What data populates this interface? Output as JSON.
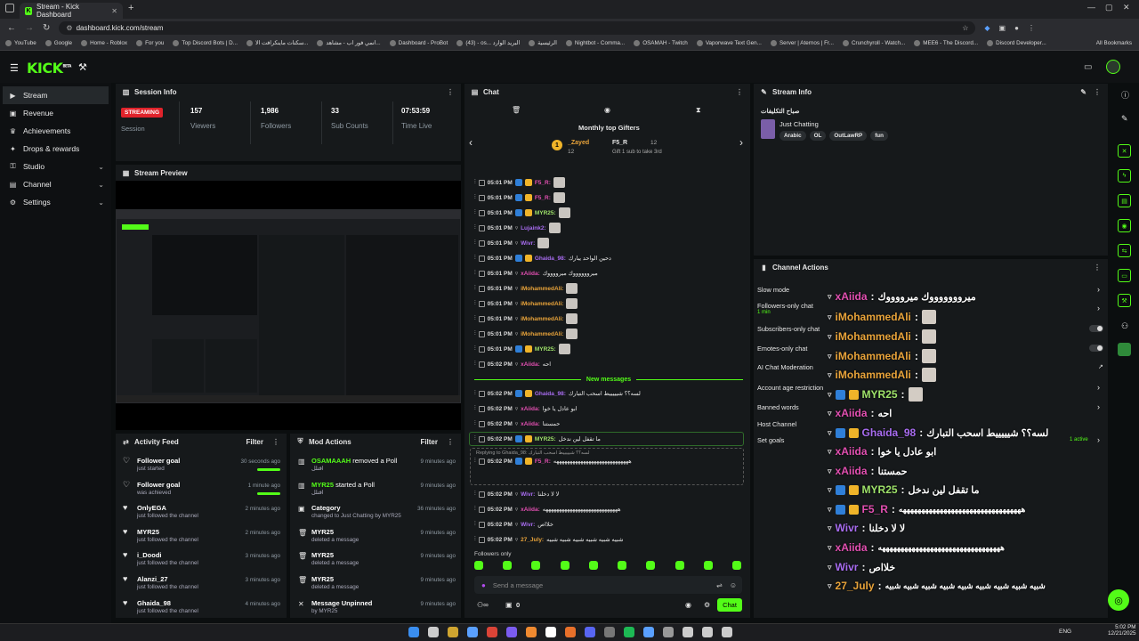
{
  "browser": {
    "tab_title": "Stream - Kick Dashboard",
    "url": "dashboard.kick.com/stream",
    "bookmarks": [
      "YouTube",
      "Google",
      "Home - Roblox",
      "For you",
      "Top Discord Bots | D...",
      "سكنات ماينكرافت الا...",
      "انمي فور اب - مشاهد...",
      "Dashboard - ProBot",
      "(43) - os... البريد الوارد",
      "الرئيسية",
      "Nightbot - Comma...",
      "OSAMAH - Twitch",
      "Vaporwave Text Gen...",
      "Server | Aternos | Fr...",
      "Crunchyroll - Watch...",
      "MEE6 - The Discord...",
      "Discord Developer..."
    ],
    "all_bookmarks": "All Bookmarks"
  },
  "app": {
    "logo": "KICK",
    "beta": "BETA"
  },
  "nav": [
    {
      "label": "Stream",
      "icon": "video-icon"
    },
    {
      "label": "Revenue",
      "icon": "wallet-icon"
    },
    {
      "label": "Achievements",
      "icon": "trophy-icon"
    },
    {
      "label": "Drops & rewards",
      "icon": "gift-icon"
    },
    {
      "label": "Studio",
      "icon": "studio-icon"
    },
    {
      "label": "Channel",
      "icon": "channel-icon"
    },
    {
      "label": "Settings",
      "icon": "gear-icon"
    }
  ],
  "session": {
    "title": "Session Info",
    "status": "STREAMING",
    "status_label": "Session",
    "stats": [
      {
        "value": "157",
        "label": "Viewers"
      },
      {
        "value": "1,986",
        "label": "Followers"
      },
      {
        "value": "33",
        "label": "Sub Counts"
      },
      {
        "value": "07:53:59",
        "label": "Time Live"
      }
    ]
  },
  "preview": {
    "title": "Stream Preview"
  },
  "activity": {
    "title": "Activity Feed",
    "filter": "Filter",
    "items": [
      {
        "title": "Follower goal",
        "sub": "just started",
        "time": "30 seconds ago",
        "bar": true
      },
      {
        "title": "Follower goal",
        "sub": "was achieved",
        "time": "1 minute ago",
        "bar": true
      },
      {
        "title": "OnlyEGA",
        "sub": "just followed the channel",
        "time": "2 minutes ago"
      },
      {
        "title": "MYR25",
        "sub": "just followed the channel",
        "time": "2 minutes ago"
      },
      {
        "title": "i_Doodi",
        "sub": "just followed the channel",
        "time": "3 minutes ago"
      },
      {
        "title": "Alanzi_27",
        "sub": "just followed the channel",
        "time": "3 minutes ago"
      },
      {
        "title": "Ghaida_98",
        "sub": "just followed the channel",
        "time": "4 minutes ago"
      }
    ]
  },
  "modactions": {
    "title": "Mod Actions",
    "filter": "Filter",
    "items": [
      {
        "user": "OSAMAAAH",
        "action": " removed a Poll",
        "sub": "اقتلل",
        "time": "9 minutes ago"
      },
      {
        "user": "MYR25",
        "action": " started a Poll",
        "sub": "اقتلل",
        "time": "9 minutes ago"
      },
      {
        "user": "",
        "action": "Category",
        "sub": "changed to Just Chatting by MYR25",
        "time": "36 minutes ago"
      },
      {
        "user": "",
        "action": "MYR25",
        "sub": "deleted a message",
        "time": "9 minutes ago"
      },
      {
        "user": "",
        "action": "MYR25",
        "sub": "deleted a message",
        "time": "9 minutes ago"
      },
      {
        "user": "",
        "action": "MYR25",
        "sub": "deleted a message",
        "time": "9 minutes ago"
      },
      {
        "user": "",
        "action": "Message Unpinned",
        "sub": "by MYR25",
        "time": "9 minutes ago"
      }
    ]
  },
  "chat": {
    "title": "Chat",
    "gifters_title": "Monthly top Gifters",
    "gifter1": "_Zayed",
    "gifter1_count": "12",
    "gifter2": "F5_R",
    "gifter2_count": "12",
    "gift_hint": "Gift 1 sub to take 3rd",
    "new_messages": "New messages",
    "followers_only": "Followers only",
    "placeholder": "Send a message",
    "send": "Chat",
    "count0": "0",
    "lines": [
      {
        "time": "05:01 PM",
        "user": "F5_R:",
        "color": "#e14fb0",
        "msg": ""
      },
      {
        "time": "05:01 PM",
        "user": "F5_R:",
        "color": "#e14fb0",
        "msg": ""
      },
      {
        "time": "05:01 PM",
        "user": "MYR25:",
        "color": "#9fe36a",
        "msg": ""
      },
      {
        "time": "05:01 PM",
        "user": "Lujaink2:",
        "color": "#a86cf0",
        "msg": ""
      },
      {
        "time": "05:01 PM",
        "user": "Wivr:",
        "color": "#a86cf0",
        "msg": ""
      },
      {
        "time": "05:01 PM",
        "user": "Ghaida_98:",
        "color": "#a86cf0",
        "msg": "دحين الواحد يبارك"
      },
      {
        "time": "05:01 PM",
        "user": "xAiida:",
        "color": "#e14fb0",
        "msg": "ميرووووووك ميرووووك"
      },
      {
        "time": "05:01 PM",
        "user": "iMohammedAli:",
        "color": "#e8a33a",
        "msg": ""
      },
      {
        "time": "05:01 PM",
        "user": "iMohammedAli:",
        "color": "#e8a33a",
        "msg": ""
      },
      {
        "time": "05:01 PM",
        "user": "iMohammedAli:",
        "color": "#e8a33a",
        "msg": ""
      },
      {
        "time": "05:01 PM",
        "user": "iMohammedAli:",
        "color": "#e8a33a",
        "msg": ""
      },
      {
        "time": "05:01 PM",
        "user": "MYR25:",
        "color": "#9fe36a",
        "msg": ""
      },
      {
        "time": "05:02 PM",
        "user": "xAiida:",
        "color": "#e14fb0",
        "msg": "احه"
      },
      {
        "time": "05:02 PM",
        "user": "Ghaida_98:",
        "color": "#a86cf0",
        "msg": "لسه؟؟ شيييييط اسحب التبارك"
      },
      {
        "time": "05:02 PM",
        "user": "xAiida:",
        "color": "#e14fb0",
        "msg": "ابو عادل يا خوا"
      },
      {
        "time": "05:02 PM",
        "user": "xAiida:",
        "color": "#e14fb0",
        "msg": "حمستنا"
      },
      {
        "time": "05:02 PM",
        "user": "MYR25:",
        "color": "#9fe36a",
        "msg": "ما تقفل لين ندخل"
      },
      {
        "time": "05:02 PM",
        "user": "F5_R:",
        "color": "#e14fb0",
        "msg": "ههههههههههههههههههههههههههههه"
      },
      {
        "time": "05:02 PM",
        "user": "Wivr:",
        "color": "#a86cf0",
        "msg": "لا لا دخلنا"
      },
      {
        "time": "05:02 PM",
        "user": "xAiida:",
        "color": "#e14fb0",
        "msg": "ههههههههههههههههههههههههههههه"
      },
      {
        "time": "05:02 PM",
        "user": "Wivr:",
        "color": "#a86cf0",
        "msg": "خلااص"
      },
      {
        "time": "05:02 PM",
        "user": "27_July:",
        "color": "#e8a33a",
        "msg": "شبيه شبيه شبيه شبيه شبيه شبيه"
      }
    ],
    "replying": "Replying to Ghaida_98: لسه؟؟ شيييييط اسحب التبارك"
  },
  "streaminfo": {
    "title": "Stream Info",
    "stream_title": "صباح التكليفات",
    "category": "Just Chatting",
    "tags": [
      "Arabic",
      "OL",
      "OutLawRP",
      "fun"
    ]
  },
  "channel_actions": {
    "title": "Channel Actions",
    "items": [
      "Slow mode",
      "Followers-only chat",
      "Subscribers-only chat",
      "Emotes-only chat",
      "AI Chat Moderation",
      "Account age restriction",
      "Banned words",
      "Host Channel",
      "Set goals"
    ],
    "followers_sub": "1 min",
    "goals_active": "1 active"
  },
  "overlay": [
    {
      "user": "xAiida",
      "color": "#e14fb0",
      "msg": "ميروووووووك ميرووووك"
    },
    {
      "user": "iMohammedAli",
      "color": "#e8a33a",
      "msg": ""
    },
    {
      "user": "iMohammedAli",
      "color": "#e8a33a",
      "msg": ""
    },
    {
      "user": "iMohammedAli",
      "color": "#e8a33a",
      "msg": ""
    },
    {
      "user": "iMohammedAli",
      "color": "#e8a33a",
      "msg": ""
    },
    {
      "user": "MYR25",
      "color": "#9fe36a",
      "msg": ""
    },
    {
      "user": "xAiida",
      "color": "#e14fb0",
      "msg": "احه"
    },
    {
      "user": "Ghaida_98",
      "color": "#a86cf0",
      "msg": "لسه؟؟ شيييييط اسحب التبارك"
    },
    {
      "user": "xAiida",
      "color": "#e14fb0",
      "msg": "ابو عادل يا خوا"
    },
    {
      "user": "xAiida",
      "color": "#e14fb0",
      "msg": "حمستنا"
    },
    {
      "user": "MYR25",
      "color": "#9fe36a",
      "msg": "ما تقفل لين ندخل"
    },
    {
      "user": "F5_R",
      "color": "#e14fb0",
      "msg": "هههههههههههههههههههههههههههههههههه"
    },
    {
      "user": "Wivr",
      "color": "#a86cf0",
      "msg": "لا لا دخلنا"
    },
    {
      "user": "xAiida",
      "color": "#e14fb0",
      "msg": "هههههههههههههههههههههههههههههههههه"
    },
    {
      "user": "Wivr",
      "color": "#a86cf0",
      "msg": "خلااص"
    },
    {
      "user": "27_July",
      "color": "#e8a33a",
      "msg": "شبيه شبيه شبيه شبيه شبيه شبيه شبيه شبيه شبيه"
    }
  ],
  "taskbar": {
    "lang": "ENG",
    "time": "5:02 PM",
    "date": "12/21/2025"
  },
  "colors": {
    "accent": "#53fc18",
    "live": "#e0232b",
    "bg": "#0b0e0f",
    "panel": "#16191b"
  }
}
